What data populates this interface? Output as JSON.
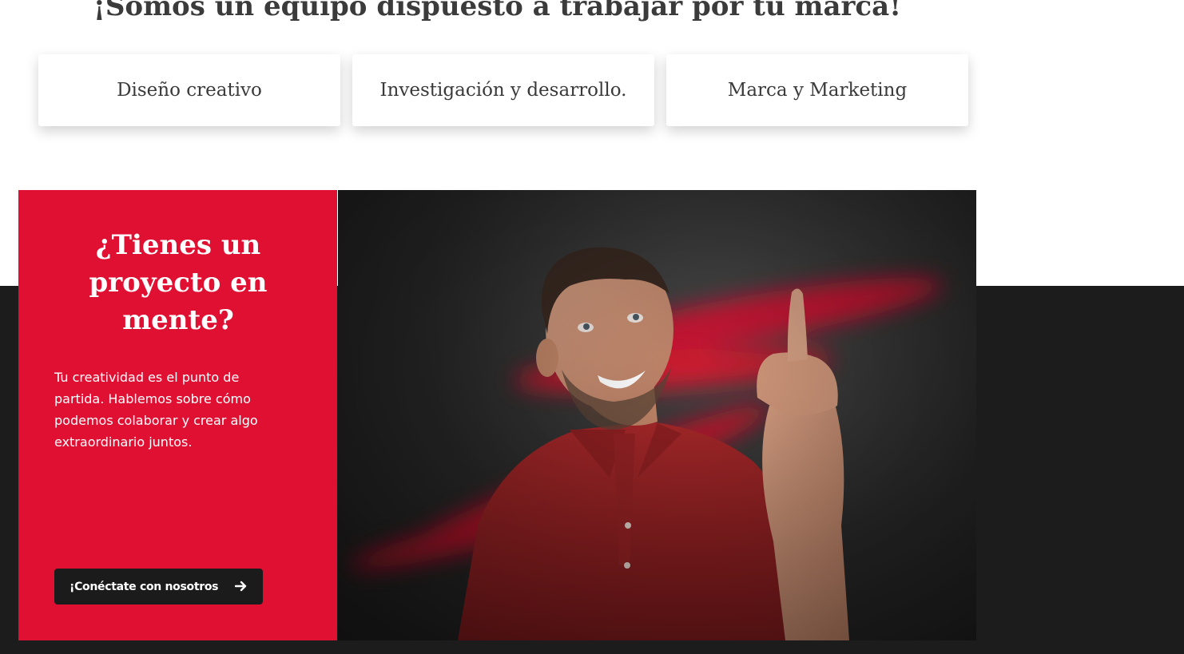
{
  "header": {
    "title": "¡Somos un equipo dispuesto a trabajar por tu marca!"
  },
  "services": [
    {
      "label": "Diseño creativo"
    },
    {
      "label": "Investigación y desarrollo."
    },
    {
      "label": "Marca y Marketing"
    }
  ],
  "cta": {
    "title": "¿Tienes un proyecto en mente?",
    "text": "Tu creatividad es el punto de partida. Hablemos sobre cómo podemos colaborar y crear algo extraordinario juntos.",
    "button_label": "¡Conéctate con nosotros",
    "button_icon": "arrow-right-icon"
  },
  "photo": {
    "subject": "man-pointing-up-photo"
  },
  "colors": {
    "accent_red": "#e01033",
    "dark_band": "#1c1c1c",
    "button_dark": "#1b1b1b",
    "heading_text": "#3b3b3b"
  }
}
